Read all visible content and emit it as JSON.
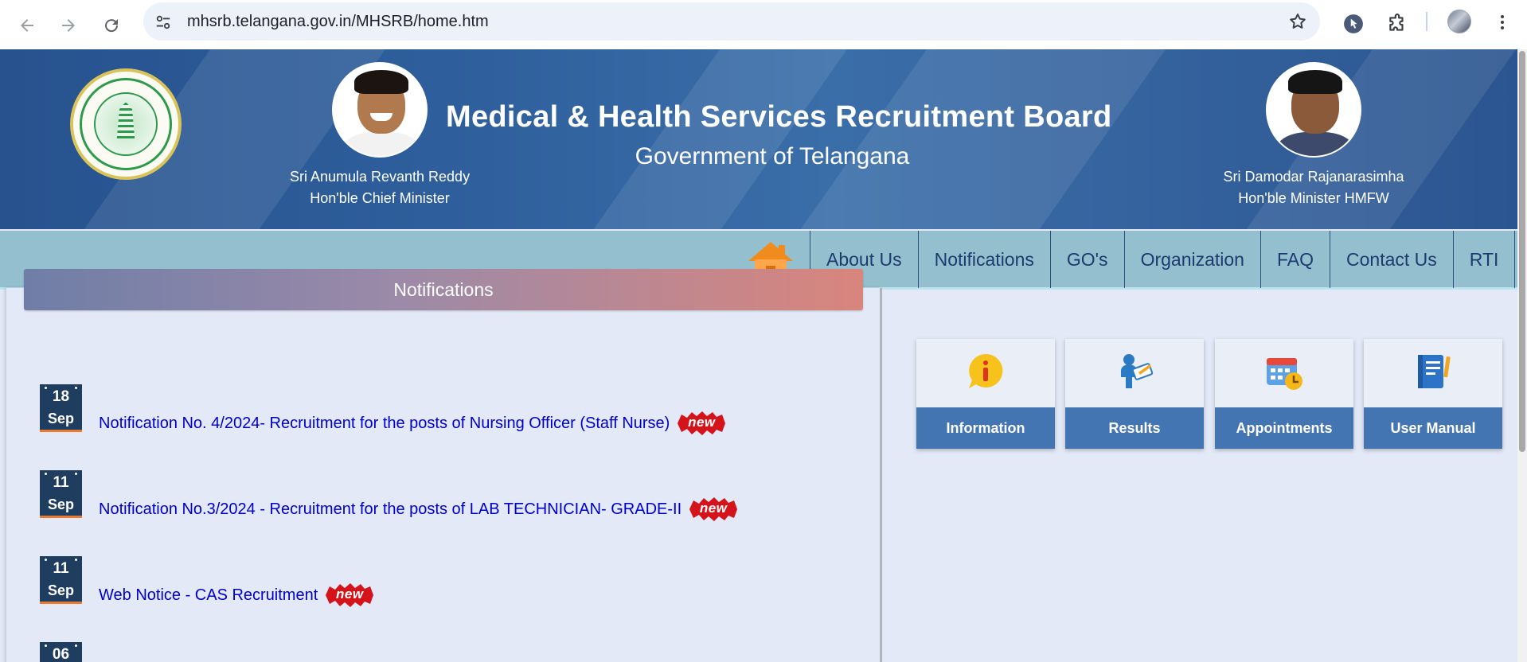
{
  "browser": {
    "url": "mhsrb.telangana.gov.in/MHSRB/home.htm"
  },
  "header": {
    "title": "Medical & Health Services Recruitment Board",
    "subtitle": "Government of Telangana",
    "left_person": {
      "name": "Sri Anumula Revanth Reddy",
      "role": "Hon'ble Chief Minister"
    },
    "right_person": {
      "name": "Sri Damodar Rajanarasimha",
      "role": "Hon'ble Minister HMFW"
    }
  },
  "nav": {
    "items": [
      {
        "label": "About Us"
      },
      {
        "label": "Notifications"
      },
      {
        "label": "GO's"
      },
      {
        "label": "Organization"
      },
      {
        "label": "FAQ"
      },
      {
        "label": "Contact Us"
      },
      {
        "label": "RTI"
      }
    ]
  },
  "notifications": {
    "heading": "Notifications",
    "new_label": "new",
    "items": [
      {
        "day": "18",
        "month": "Sep",
        "text": "Notification No. 4/2024- Recruitment for the posts of Nursing Officer (Staff Nurse)",
        "is_new": true
      },
      {
        "day": "11",
        "month": "Sep",
        "text": "Notification No.3/2024 - Recruitment for the posts of LAB TECHNICIAN- GRADE-II",
        "is_new": true
      },
      {
        "day": "11",
        "month": "Sep",
        "text": "Web Notice - CAS Recruitment",
        "is_new": true
      },
      {
        "day": "06",
        "month": "",
        "text": ""
      }
    ]
  },
  "tiles": [
    {
      "label": "Information",
      "icon": "info-icon"
    },
    {
      "label": "Results",
      "icon": "results-icon"
    },
    {
      "label": "Appointments",
      "icon": "calendar-icon"
    },
    {
      "label": "User Manual",
      "icon": "manual-icon"
    }
  ],
  "colors": {
    "banner": "#2e5f9c",
    "navbar": "#94bfcf",
    "tile_label": "#4475b3",
    "link": "#0000cc",
    "new_badge": "#d4141a"
  }
}
